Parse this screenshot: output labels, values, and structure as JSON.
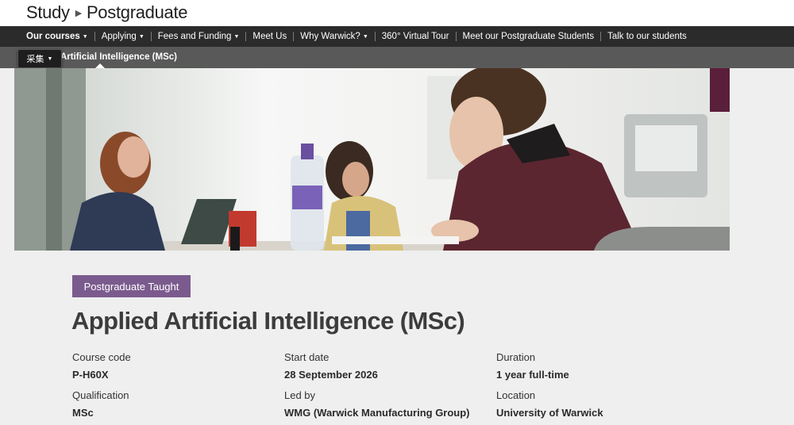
{
  "header": {
    "section": "Study",
    "page": "Postgraduate"
  },
  "nav": {
    "items": [
      {
        "label": "Our courses",
        "dropdown": true,
        "active": true
      },
      {
        "label": "Applying",
        "dropdown": true
      },
      {
        "label": "Fees and Funding",
        "dropdown": true
      },
      {
        "label": "Meet Us",
        "dropdown": false
      },
      {
        "label": "Why Warwick?",
        "dropdown": true
      },
      {
        "label": "360° Virtual Tour",
        "dropdown": false
      },
      {
        "label": "Meet our Postgraduate Students",
        "dropdown": false
      },
      {
        "label": "Talk to our students",
        "dropdown": false
      }
    ]
  },
  "subnav": {
    "title": "Artificial Intelligence (MSc)"
  },
  "collect_button": {
    "label": "采集"
  },
  "hero": {
    "icon": "students-studying-photo"
  },
  "course": {
    "badge": "Postgraduate Taught",
    "title": "Applied Artificial Intelligence (MSc)",
    "badge_color": "#7b5b8e",
    "facts": [
      {
        "label": "Course code",
        "value": "P-H60X"
      },
      {
        "label": "Start date",
        "value": "28 September 2026"
      },
      {
        "label": "Duration",
        "value": "1 year full-time"
      },
      {
        "label": "Qualification",
        "value": "MSc"
      },
      {
        "label": "Led by",
        "value": "WMG (Warwick Manufacturing Group)"
      },
      {
        "label": "Location",
        "value": "University of Warwick"
      }
    ]
  }
}
